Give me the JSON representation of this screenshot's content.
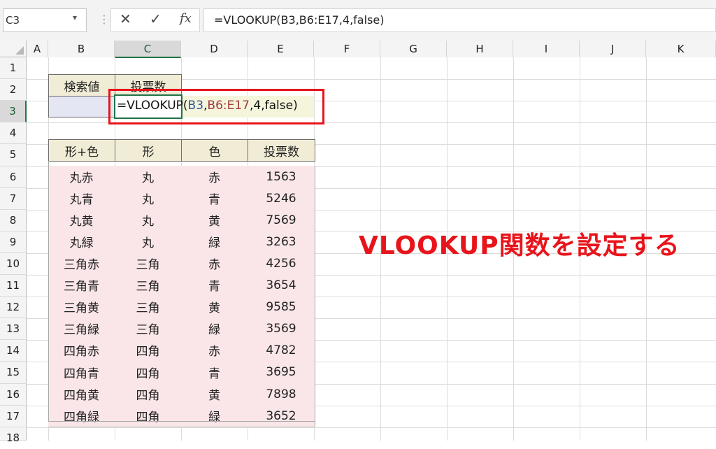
{
  "formula_bar": {
    "name_box": "C3",
    "name_box_arrow": "▾",
    "separator": "⋮",
    "cancel_icon": "✕",
    "enter_icon": "✓",
    "fx_label": "fx",
    "formula": "=VLOOKUP(B3,B6:E17,4,false)"
  },
  "columns": [
    "A",
    "B",
    "C",
    "D",
    "E",
    "F",
    "G",
    "H",
    "I",
    "J",
    "K"
  ],
  "selected_column": "C",
  "rows": [
    "1",
    "2",
    "3",
    "4",
    "5",
    "6",
    "7",
    "8",
    "9",
    "10",
    "11",
    "12",
    "13",
    "14",
    "15",
    "16",
    "17",
    "18"
  ],
  "selected_row": "3",
  "lookup_table": {
    "headers": [
      "検索値",
      "投票数"
    ],
    "search_value": "",
    "cell_formula": {
      "prefix": "=VLOOKUP(",
      "ref1": "B3",
      "comma1": ",",
      "ref2": "B6:E17",
      "suffix": ",4,false)"
    }
  },
  "data_table": {
    "headers": [
      "形+色",
      "形",
      "色",
      "投票数"
    ],
    "rows": [
      [
        "丸赤",
        "丸",
        "赤",
        "1563"
      ],
      [
        "丸青",
        "丸",
        "青",
        "5246"
      ],
      [
        "丸黄",
        "丸",
        "黄",
        "7569"
      ],
      [
        "丸緑",
        "丸",
        "緑",
        "3263"
      ],
      [
        "三角赤",
        "三角",
        "赤",
        "4256"
      ],
      [
        "三角青",
        "三角",
        "青",
        "3654"
      ],
      [
        "三角黄",
        "三角",
        "黄",
        "9585"
      ],
      [
        "三角緑",
        "三角",
        "緑",
        "3569"
      ],
      [
        "四角赤",
        "四角",
        "赤",
        "4782"
      ],
      [
        "四角青",
        "四角",
        "青",
        "3695"
      ],
      [
        "四角黄",
        "四角",
        "黄",
        "7898"
      ],
      [
        "四角緑",
        "四角",
        "緑",
        "3652"
      ]
    ]
  },
  "annotation": "VLOOKUP関数を設定する",
  "colors": {
    "accent_red": "#e8141b",
    "excel_green": "#217346",
    "header_fill": "#f0ecd6",
    "data_fill": "#fae6e8",
    "lookup_fill": "#e4e6f4"
  }
}
